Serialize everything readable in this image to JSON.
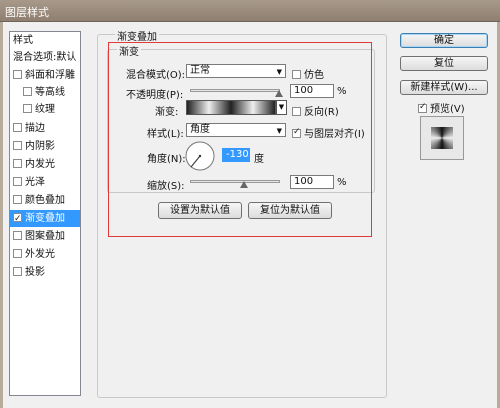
{
  "window": {
    "title": "图层样式"
  },
  "sidebar": {
    "items": [
      {
        "label": "样式",
        "checkbox": false,
        "checked": false
      },
      {
        "label": "混合选项:默认",
        "checkbox": false,
        "checked": false
      },
      {
        "label": "斜面和浮雕",
        "checkbox": true,
        "checked": false
      },
      {
        "label": "等高线",
        "checkbox": true,
        "checked": false
      },
      {
        "label": "纹理",
        "checkbox": true,
        "checked": false
      },
      {
        "label": "描边",
        "checkbox": true,
        "checked": false
      },
      {
        "label": "内阴影",
        "checkbox": true,
        "checked": false
      },
      {
        "label": "内发光",
        "checkbox": true,
        "checked": false
      },
      {
        "label": "光泽",
        "checkbox": true,
        "checked": false
      },
      {
        "label": "颜色叠加",
        "checkbox": true,
        "checked": false
      },
      {
        "label": "渐变叠加",
        "checkbox": true,
        "checked": true
      },
      {
        "label": "图案叠加",
        "checkbox": true,
        "checked": false
      },
      {
        "label": "外发光",
        "checkbox": true,
        "checked": false
      },
      {
        "label": "投影",
        "checkbox": true,
        "checked": false
      }
    ]
  },
  "panel": {
    "group_title": "渐变叠加",
    "subgroup_title": "渐变",
    "blend_mode": {
      "label": "混合模式(O):",
      "value": "正常"
    },
    "dither": {
      "label": "仿色",
      "checked": false
    },
    "opacity": {
      "label": "不透明度(P):",
      "value": "100",
      "unit": "%",
      "level": 1.0
    },
    "gradient": {
      "label": "渐变:"
    },
    "reverse": {
      "label": "反向(R)",
      "checked": false
    },
    "style": {
      "label": "样式(L):",
      "value": "角度"
    },
    "align": {
      "label": "与图层对齐(I)",
      "checked": true
    },
    "angle": {
      "label": "角度(N):",
      "value": "-130",
      "unit": "度"
    },
    "scale": {
      "label": "缩放(S):",
      "value": "100",
      "unit": "%",
      "level": 0.5
    },
    "set_default_label": "设置为默认值",
    "reset_default_label": "复位为默认值"
  },
  "buttons": {
    "ok": "确定",
    "reset": "复位",
    "new_style": "新建样式(W)..."
  },
  "preview": {
    "label": "预览(V)",
    "checked": true
  },
  "colors": {
    "selection": "#3399ff",
    "red_box": "#e03a3a"
  }
}
